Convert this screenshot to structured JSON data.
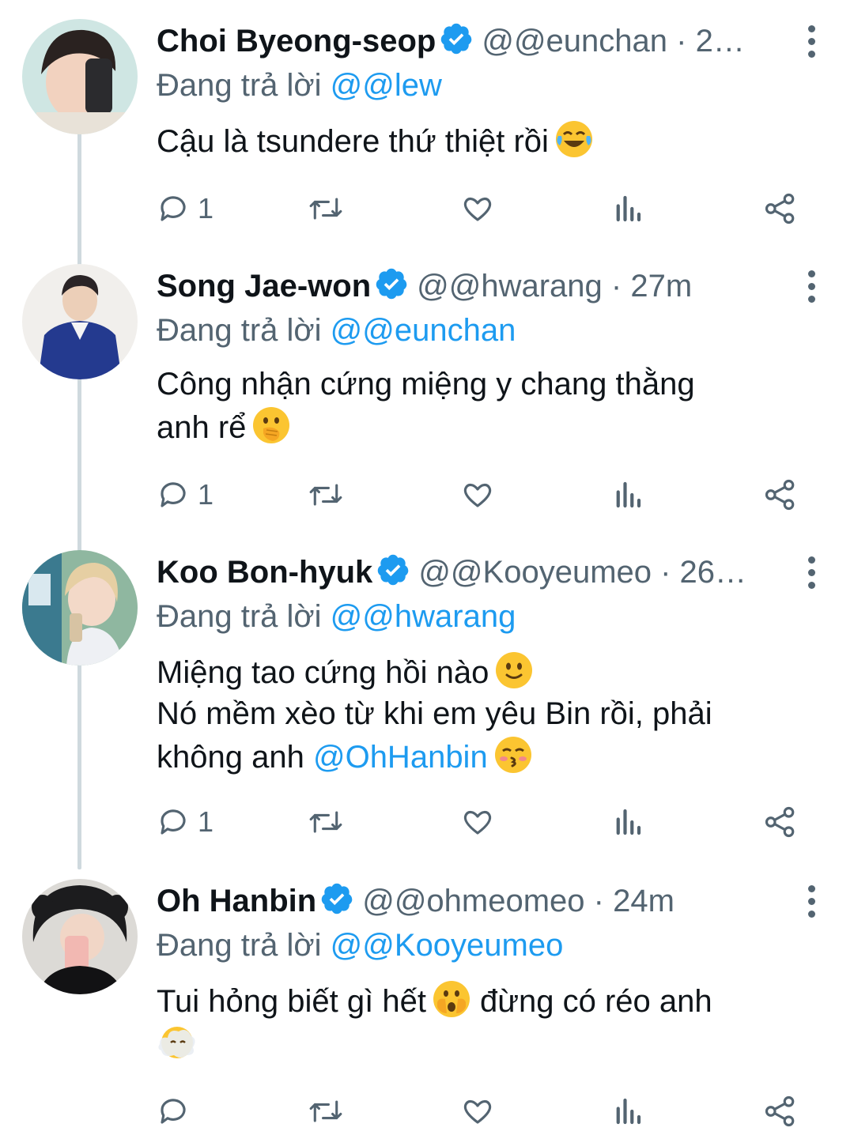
{
  "colors": {
    "accent": "#1d9bf0",
    "muted": "#536471",
    "text": "#0f1419",
    "thread_line": "#cfd9de"
  },
  "tweets": [
    {
      "name": "Choi Byeong-seop",
      "handle": "@@eunchan",
      "time": "2…",
      "reply_label": "Đang trả lời",
      "reply_to": "@@lew",
      "lines": [
        "Cậu là tsundere thứ thiệt rồi"
      ],
      "emojis": [
        "face-with-tears-of-joy"
      ],
      "reply_count": "1"
    },
    {
      "name": "Song Jae-won",
      "handle": "@@hwarang",
      "time": "27m",
      "reply_label": "Đang trả lời",
      "reply_to": "@@eunchan",
      "lines": [
        "Công nhận cứng miệng y chang thằng",
        "anh rể"
      ],
      "emojis": [
        "face-with-hand-over-mouth"
      ],
      "reply_count": "1"
    },
    {
      "name": "Koo Bon-hyuk",
      "handle": "@@Kooyeumeo",
      "time": "26…",
      "reply_label": "Đang trả lời",
      "reply_to": "@@hwarang",
      "lines": [
        "Miệng tao cứng hồi nào",
        "Nó mềm xèo từ khi em yêu Bin rồi, phải",
        "không anh"
      ],
      "mention": "@OhHanbin",
      "emojis": [
        "slightly-smiling-face",
        "kissing-face-with-closed-eyes"
      ],
      "reply_count": "1"
    },
    {
      "name": "Oh Hanbin",
      "handle": "@@ohmeomeo",
      "time": "24m",
      "reply_label": "Đang trả lời",
      "reply_to": "@@Kooyeumeo",
      "lines": [
        "Tui hỏng biết gì hết",
        "đừng có réo anh"
      ],
      "emojis": [
        "face-with-open-eyes-and-hand-over-mouth",
        "face-in-clouds"
      ],
      "reply_count": ""
    }
  ],
  "icons": {
    "verified": "verified-badge-icon",
    "more": "more-options-icon",
    "reply": "reply-icon",
    "retweet": "retweet-icon",
    "like": "heart-icon",
    "views": "views-icon",
    "share": "share-icon"
  }
}
